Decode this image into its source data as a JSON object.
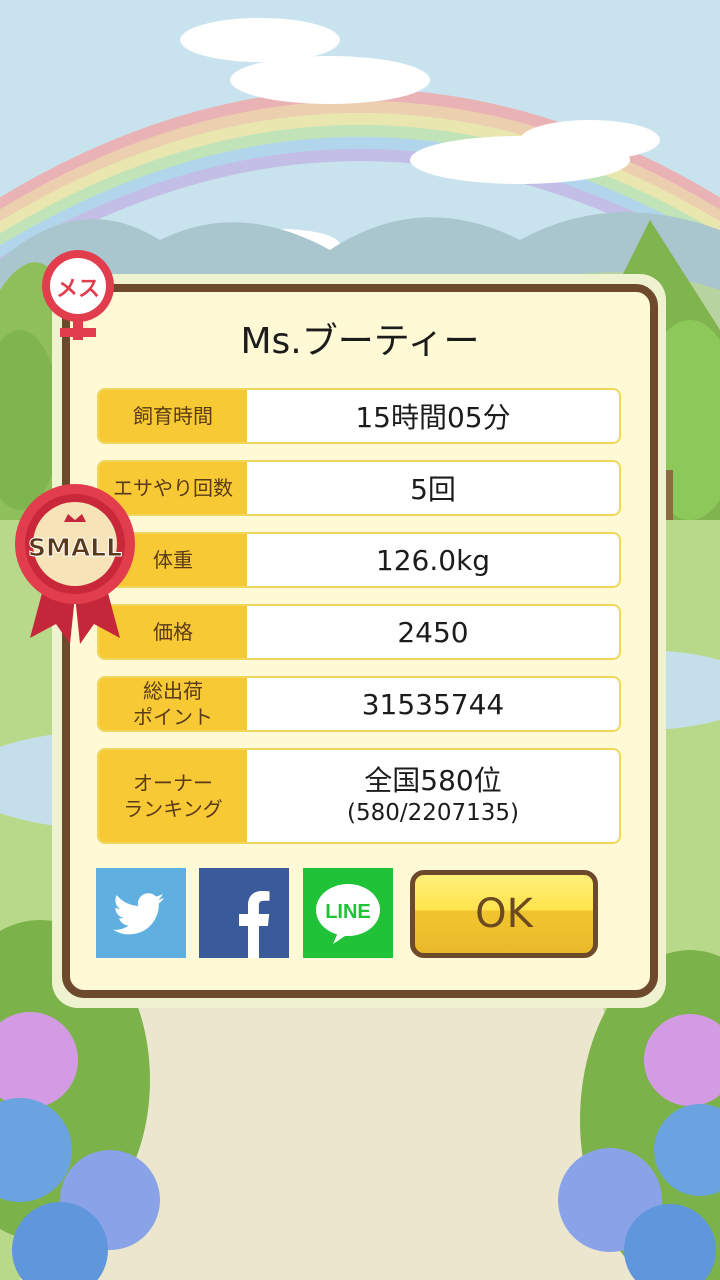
{
  "pet": {
    "name": "Ms.ブーティー",
    "gender_badge": "メス",
    "size_badge": "SMALL"
  },
  "stats": [
    {
      "label": "飼育時間",
      "value": "15時間05分"
    },
    {
      "label": "エサやり回数",
      "value": "5回"
    },
    {
      "label": "体重",
      "value": "126.0kg"
    },
    {
      "label": "価格",
      "value": "2450"
    },
    {
      "label_line1": "総出荷",
      "label_line2": "ポイント",
      "value": "31535744"
    },
    {
      "label_line1": "オーナー",
      "label_line2": "ランキング",
      "value_line1": "全国580位",
      "value_line2": "(580/2207135)"
    }
  ],
  "share": {
    "twitter_icon": "twitter-bird-icon",
    "facebook_icon": "facebook-f-icon",
    "line_label": "LINE"
  },
  "ok_label": "OK"
}
